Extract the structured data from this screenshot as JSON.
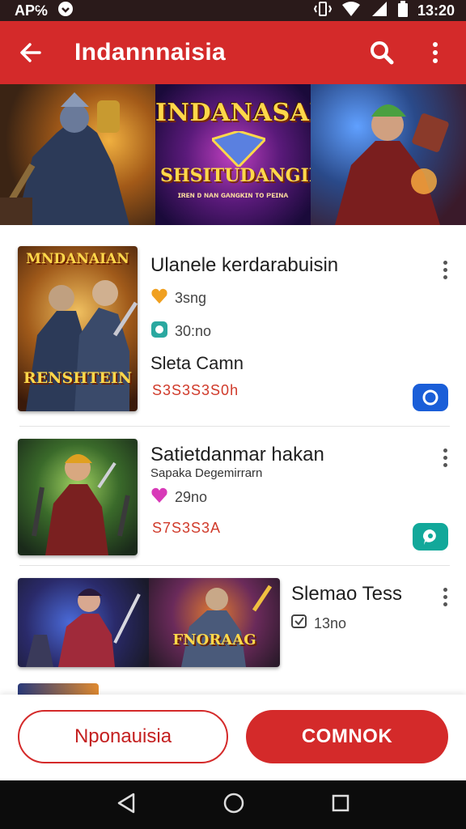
{
  "status_bar": {
    "left_text": "AP℅",
    "time": "13:20",
    "icons": [
      "notification-icon",
      "vibrate-icon",
      "wifi-icon",
      "signal-icon",
      "battery-icon"
    ]
  },
  "app_bar": {
    "title": "Indannnaisia",
    "icons": [
      "back-arrow-icon",
      "search-icon",
      "more-vert-icon"
    ],
    "color": "#d42a2a"
  },
  "banner": {
    "title": "INDANASAI",
    "subtitle": "SHSITUDANGIKIN",
    "tiny": "ɪʀᴇɴ ᴅ ɴᴀɴ ɢᴀɴɢᴋɪɴ ᴛᴏ ᴘᴇɪɴᴀ"
  },
  "items": [
    {
      "title": "Ulanele kerdarabuisin",
      "thumb_top": "MNDANAIAN",
      "thumb_bottom": "RENSHTEIN",
      "rating": "3sng",
      "reviews": "30:no",
      "tag": "Sleta Camn",
      "price": "S3S3S3S0h",
      "badge_color": "#1a5ed8",
      "badge_icon": "circle-icon"
    },
    {
      "title": "Satietdanmar hakan",
      "subtitle": "Sapaka Degemirrarn",
      "rating": "29no",
      "price": "S7S3S3A",
      "badge_color": "#12a89a",
      "badge_icon": "chat-icon"
    },
    {
      "title": "Slemao Tess",
      "thumb_label": "FNORAAG",
      "reviews": "13no"
    }
  ],
  "buttons": {
    "secondary": "Nponauisia",
    "primary": "COMNOK"
  },
  "nav": [
    "back-icon",
    "home-icon",
    "recents-icon"
  ]
}
